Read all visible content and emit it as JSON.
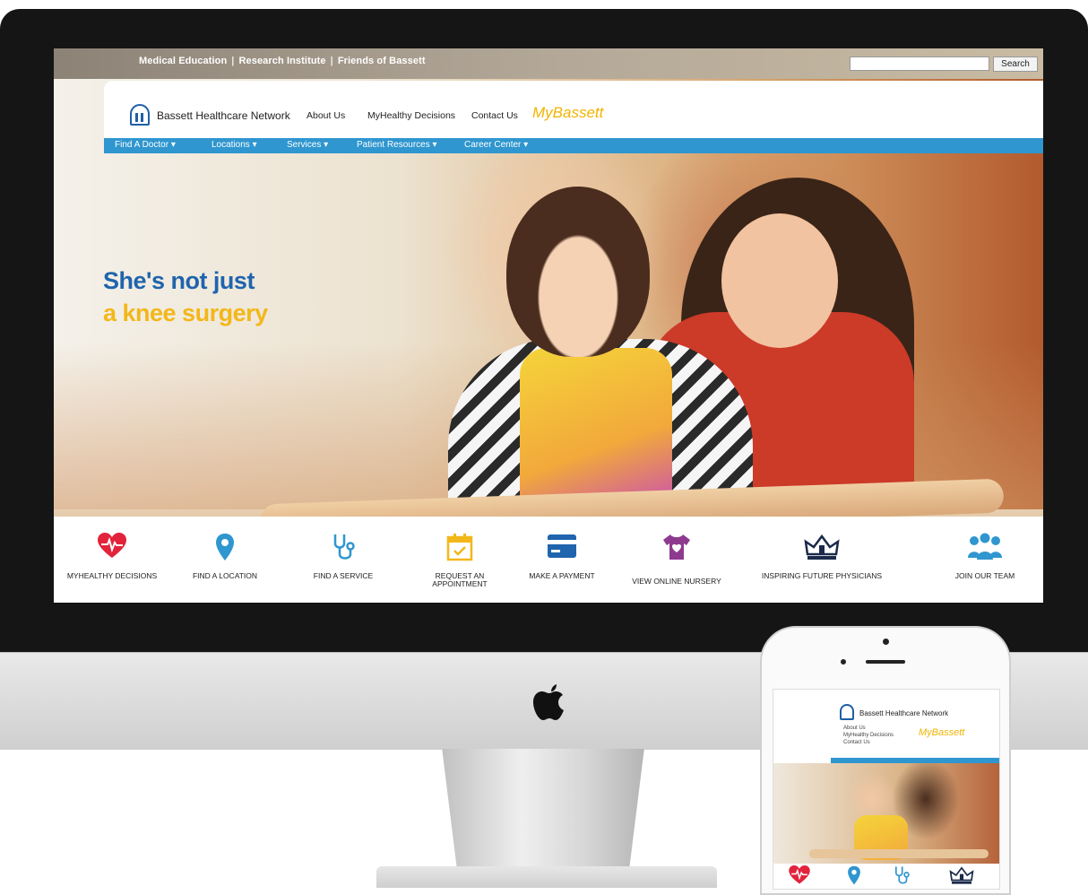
{
  "site": {
    "utility_links": [
      "Medical Education",
      "Research Institute",
      "Friends of Bassett"
    ],
    "search_placeholder": "",
    "search_button": "Search",
    "brand": "Bassett Healthcare Network",
    "top_links": [
      "About Us",
      "MyHealthy Decisions",
      "Contact Us"
    ],
    "mybassett": "MyBassett",
    "main_nav": [
      "Find A Doctor",
      "Locations",
      "Services",
      "Patient Resources",
      "Career Center"
    ],
    "headline_line1": "She's not just",
    "headline_line2": "a knee surgery",
    "quick_links": [
      {
        "label": "MYHEALTHY DECISIONS",
        "icon": "heart-pulse-icon",
        "color": "#e2233b"
      },
      {
        "label": "FIND A LOCATION",
        "icon": "map-pin-icon",
        "color": "#2f96cf"
      },
      {
        "label": "FIND A SERVICE",
        "icon": "stethoscope-icon",
        "color": "#2f96cf"
      },
      {
        "label": "REQUEST AN APPOINTMENT",
        "icon": "calendar-check-icon",
        "color": "#f3b71a"
      },
      {
        "label": "MAKE A PAYMENT",
        "icon": "credit-card-icon",
        "color": "#1f64ad"
      },
      {
        "label": "VIEW ONLINE NURSERY",
        "icon": "baby-onesie-icon",
        "color": "#8e3a8f"
      },
      {
        "label": "INSPIRING FUTURE PHYSICIANS",
        "icon": "crown-icon",
        "color": "#1b2a4a"
      },
      {
        "label": "JOIN OUR TEAM",
        "icon": "team-icon",
        "color": "#2f96cf"
      }
    ]
  },
  "phone": {
    "brand": "Bassett Healthcare Network",
    "links": [
      "About Us",
      "MyHealthy Decisions",
      "Contact Us"
    ],
    "mybassett": "MyBassett"
  },
  "colors": {
    "brand_blue": "#1f64ad",
    "nav_blue": "#2f96cf",
    "accent_yellow": "#f3b71a"
  }
}
